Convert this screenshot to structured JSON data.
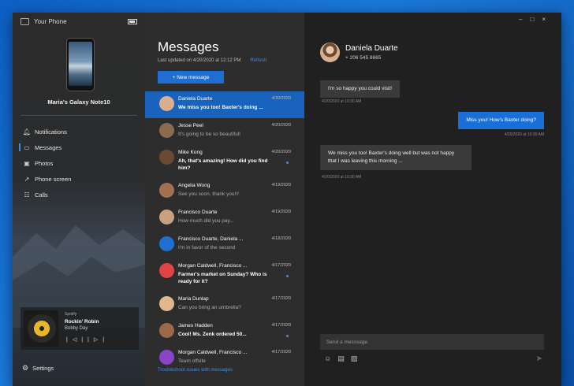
{
  "app": {
    "title": "Your Phone"
  },
  "device": {
    "name": "Maria's Galaxy Note10"
  },
  "nav": {
    "items": [
      {
        "label": "Notifications",
        "icon": "bell-icon"
      },
      {
        "label": "Messages",
        "icon": "message-icon",
        "active": true
      },
      {
        "label": "Photos",
        "icon": "photo-icon"
      },
      {
        "label": "Phone screen",
        "icon": "phone-screen-icon"
      },
      {
        "label": "Calls",
        "icon": "calls-icon"
      }
    ],
    "settings_label": "Settings"
  },
  "media": {
    "source": "Spotify",
    "title": "Rockin' Robin",
    "artist": "Bobby Day"
  },
  "messages": {
    "heading": "Messages",
    "updated": "Last updated on 4/20/2020 at 12:12 PM",
    "refresh": "Refresh",
    "new_button": "+ New message",
    "troubleshoot": "Troubleshoot issues with messages",
    "conversations": [
      {
        "name": "Daniela Duarte",
        "date": "4/20/2020",
        "preview": "We miss you too! Baxter's doing ...",
        "unread": true,
        "selected": true,
        "avatar_color": "#d9b08f"
      },
      {
        "name": "Jesse Peel",
        "date": "4/20/2020",
        "preview": "It's going to be so beautiful!",
        "unread": false,
        "avatar_color": "#8a6a50"
      },
      {
        "name": "Mike Kong",
        "date": "4/20/2020",
        "preview": "Ah, that's amazing! How did you find him?",
        "unread": true,
        "avatar_color": "#6b4a33"
      },
      {
        "name": "Angelia Wong",
        "date": "4/19/2020",
        "preview": "See you soon, thank you!!!",
        "unread": false,
        "avatar_color": "#a07050"
      },
      {
        "name": "Francisco Duarte",
        "date": "4/19/2020",
        "preview": "How much did you pay...",
        "unread": false,
        "avatar_color": "#c8a080"
      },
      {
        "name": "Francisco Duarte, Daniela ...",
        "date": "4/18/2020",
        "preview": "I'm in favor of the second",
        "unread": false,
        "avatar_color": "#1f6fd0"
      },
      {
        "name": "Morgan Caldwell, Francisco ...",
        "date": "4/17/2020",
        "preview": "Farmer's market on Sunday? Who is ready for it?",
        "unread": true,
        "avatar_color": "#e04444"
      },
      {
        "name": "Maria Dunlap",
        "date": "4/17/2020",
        "preview": "Can you bring an umbrella?",
        "unread": false,
        "avatar_color": "#e0b890"
      },
      {
        "name": "James Hadden",
        "date": "4/17/2020",
        "preview": "Cool! Ms. Zenk ordered 50...",
        "unread": true,
        "avatar_color": "#9a6a48"
      },
      {
        "name": "Morgan Caldwell, Francisco ...",
        "date": "4/17/2020",
        "preview": "Team offsite",
        "unread": false,
        "avatar_color": "#8a44c8"
      }
    ]
  },
  "chat": {
    "contact_name": "Daniela Duarte",
    "contact_phone": "+ 206 545 8665",
    "messages": [
      {
        "text": "I'm so happy you could visit!",
        "time": "4/20/2020 at 10:30 AM",
        "direction": "in"
      },
      {
        "text": "Miss you! How's Baxter doing?",
        "time": "4/20/2020 at 10:30 AM",
        "direction": "out"
      },
      {
        "text": "We miss you too! Baxter's doing well but was not happy that I was leaving this morning ...",
        "time": "4/20/2020 at 10:30 AM",
        "direction": "in"
      }
    ],
    "compose_placeholder": "Send a messsage"
  },
  "colors": {
    "accent": "#1f6fd0",
    "selected_row": "#1a63bd",
    "outgoing_bubble": "#1a6fd6",
    "incoming_bubble": "#3a3a3a"
  }
}
